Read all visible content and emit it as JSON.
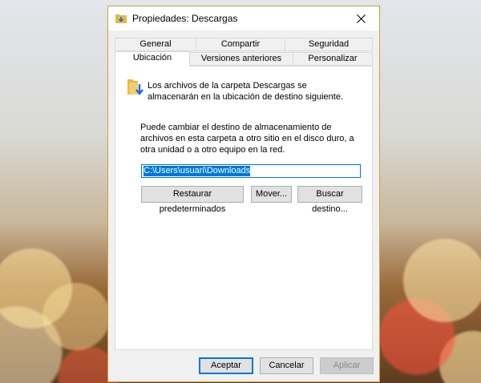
{
  "window": {
    "title": "Propiedades: Descargas",
    "close_label": "✕"
  },
  "tabs_top": [
    "General",
    "Compartir",
    "Seguridad"
  ],
  "tabs_bottom": [
    "Ubicación",
    "Versiones anteriores",
    "Personalizar"
  ],
  "panel": {
    "description1": "Los archivos de la carpeta Descargas se almacenarán en la ubicación de destino siguiente.",
    "description2": "Puede cambiar el destino de almacenamiento de archivos en esta carpeta a otro sitio en el disco duro, a otra unidad o a otro equipo en la red.",
    "path_value": "C:\\Users\\usuari\\Downloads",
    "restore_label": "Restaurar predeterminados",
    "move_label": "Mover...",
    "find_label": "Buscar destino..."
  },
  "footer": {
    "ok_label": "Aceptar",
    "cancel_label": "Cancelar",
    "apply_label": "Aplicar"
  },
  "colors": {
    "accent": "#0078d7",
    "window_border": "#c7a23e",
    "folder": "#e8b84a"
  }
}
